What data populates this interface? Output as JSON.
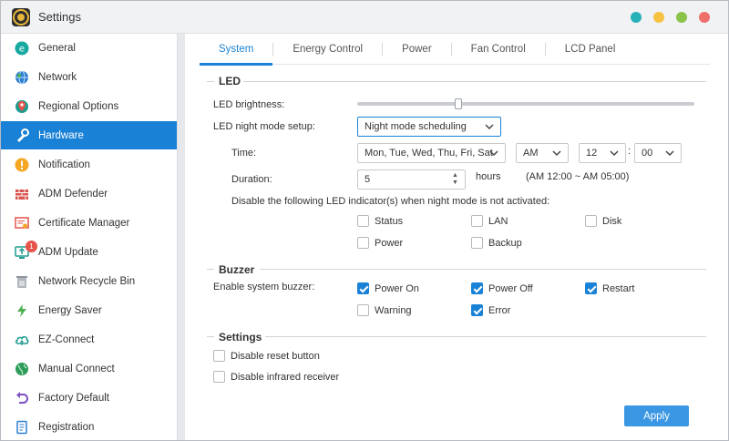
{
  "window": {
    "title": "Settings"
  },
  "title_buttons": [
    {
      "name": "teal-window-button",
      "color": "#26b0b7"
    },
    {
      "name": "yellow-window-button",
      "color": "#f5c242"
    },
    {
      "name": "green-window-button",
      "color": "#8bc34a"
    },
    {
      "name": "red-window-button",
      "color": "#ef6f6c"
    }
  ],
  "sidebar": {
    "items": [
      {
        "label": "General",
        "icon": "general-icon",
        "active": false
      },
      {
        "label": "Network",
        "icon": "network-icon",
        "active": false
      },
      {
        "label": "Regional Options",
        "icon": "regional-options-icon",
        "active": false
      },
      {
        "label": "Hardware",
        "icon": "hardware-icon",
        "active": true
      },
      {
        "label": "Notification",
        "icon": "notification-icon",
        "active": false
      },
      {
        "label": "ADM Defender",
        "icon": "firewall-icon",
        "active": false
      },
      {
        "label": "Certificate Manager",
        "icon": "certificate-icon",
        "active": false
      },
      {
        "label": "ADM Update",
        "icon": "update-icon",
        "active": false,
        "badge": "1"
      },
      {
        "label": "Network Recycle Bin",
        "icon": "recycle-bin-icon",
        "active": false
      },
      {
        "label": "Energy Saver",
        "icon": "energy-saver-icon",
        "active": false
      },
      {
        "label": "EZ-Connect",
        "icon": "cloud-icon",
        "active": false
      },
      {
        "label": "Manual Connect",
        "icon": "globe-icon",
        "active": false
      },
      {
        "label": "Factory Default",
        "icon": "undo-icon",
        "active": false
      },
      {
        "label": "Registration",
        "icon": "registration-icon",
        "active": false
      }
    ]
  },
  "tabs": [
    {
      "label": "System",
      "active": true
    },
    {
      "label": "Energy Control",
      "active": false
    },
    {
      "label": "Power",
      "active": false
    },
    {
      "label": "Fan Control",
      "active": false
    },
    {
      "label": "LCD Panel",
      "active": false
    }
  ],
  "led": {
    "title": "LED",
    "brightness_label": "LED brightness:",
    "brightness_level": 0.3,
    "night_mode_label": "LED night mode setup:",
    "night_mode_value": "Night mode scheduling",
    "time_label": "Time:",
    "days_value": "Mon, Tue, Wed, Thu, Fri, Sat",
    "ampm_value": "AM",
    "hour_value": "12",
    "colon": ":",
    "minute_value": "00",
    "duration_label": "Duration:",
    "duration_value": "5",
    "hours_label": "hours",
    "range_text": "(AM 12:00 ~ AM 05:00)",
    "disable_label": "Disable the following LED indicator(s) when night mode is not activated:",
    "indicators": [
      {
        "label": "Status",
        "checked": false
      },
      {
        "label": "LAN",
        "checked": false
      },
      {
        "label": "Disk",
        "checked": false
      },
      {
        "label": "Power",
        "checked": false
      },
      {
        "label": "Backup",
        "checked": false
      }
    ]
  },
  "buzzer": {
    "title": "Buzzer",
    "enable_label": "Enable system buzzer:",
    "options": [
      {
        "label": "Power On",
        "checked": true
      },
      {
        "label": "Power Off",
        "checked": true
      },
      {
        "label": "Restart",
        "checked": true
      },
      {
        "label": "Warning",
        "checked": false
      },
      {
        "label": "Error",
        "checked": true
      }
    ]
  },
  "settings": {
    "title": "Settings",
    "options": [
      {
        "label": "Disable reset button",
        "checked": false
      },
      {
        "label": "Disable infrared receiver",
        "checked": false
      }
    ]
  },
  "apply_label": "Apply",
  "colors": {
    "accent": "#1a82d6",
    "apply": "#3b97e3"
  }
}
